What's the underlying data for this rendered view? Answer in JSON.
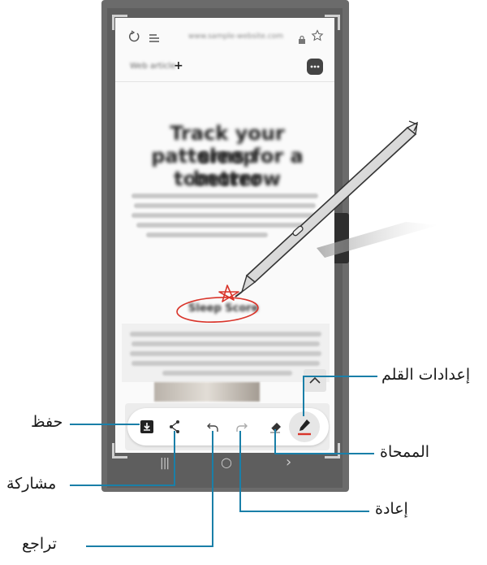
{
  "browser": {
    "url_text": "www.sample-website.com",
    "tab_text": "Web article"
  },
  "article": {
    "title_line1": "Track your sleep",
    "title_line2": "patterns for a better",
    "title_line3": "tomorrow",
    "highlight_text": "Sleep Score"
  },
  "toolbar": {
    "save_icon": "download-icon",
    "share_icon": "share-icon",
    "undo_icon": "undo-icon",
    "redo_icon": "redo-icon",
    "eraser_icon": "eraser-icon",
    "pen_icon": "pen-icon"
  },
  "nav_bar": {
    "recent_glyph": "|||",
    "home_glyph": "○",
    "back_glyph": "›"
  },
  "labels": {
    "save": "حفظ",
    "share": "مشاركة",
    "undo": "تراجع",
    "pen_settings": "إعدادات القلم",
    "eraser": "الممحاة",
    "redo": "إعادة"
  },
  "colors": {
    "callout": "#1a7fa8",
    "annotation_red": "#d9352b"
  }
}
